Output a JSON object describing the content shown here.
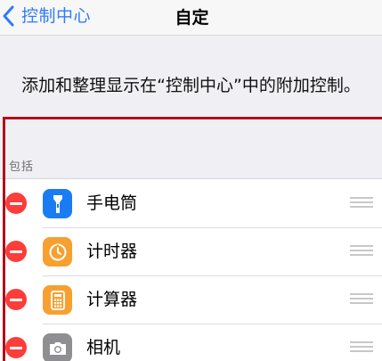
{
  "navbar": {
    "back_label": "控制中心",
    "title": "自定"
  },
  "description": "添加和整理显示在“控制中心”中的附加控制。",
  "section": {
    "header": "包括",
    "items": [
      {
        "label": "手电筒",
        "icon": "flashlight-icon",
        "color": "#1a7cf5"
      },
      {
        "label": "计时器",
        "icon": "timer-icon",
        "color": "#f7a030"
      },
      {
        "label": "计算器",
        "icon": "calculator-icon",
        "color": "#f7a030"
      },
      {
        "label": "相机",
        "icon": "camera-icon",
        "color": "#8e8e93"
      }
    ]
  },
  "colors": {
    "accent": "#2f7cf6",
    "remove": "#fc3d39",
    "annotation": "#b1101c"
  }
}
